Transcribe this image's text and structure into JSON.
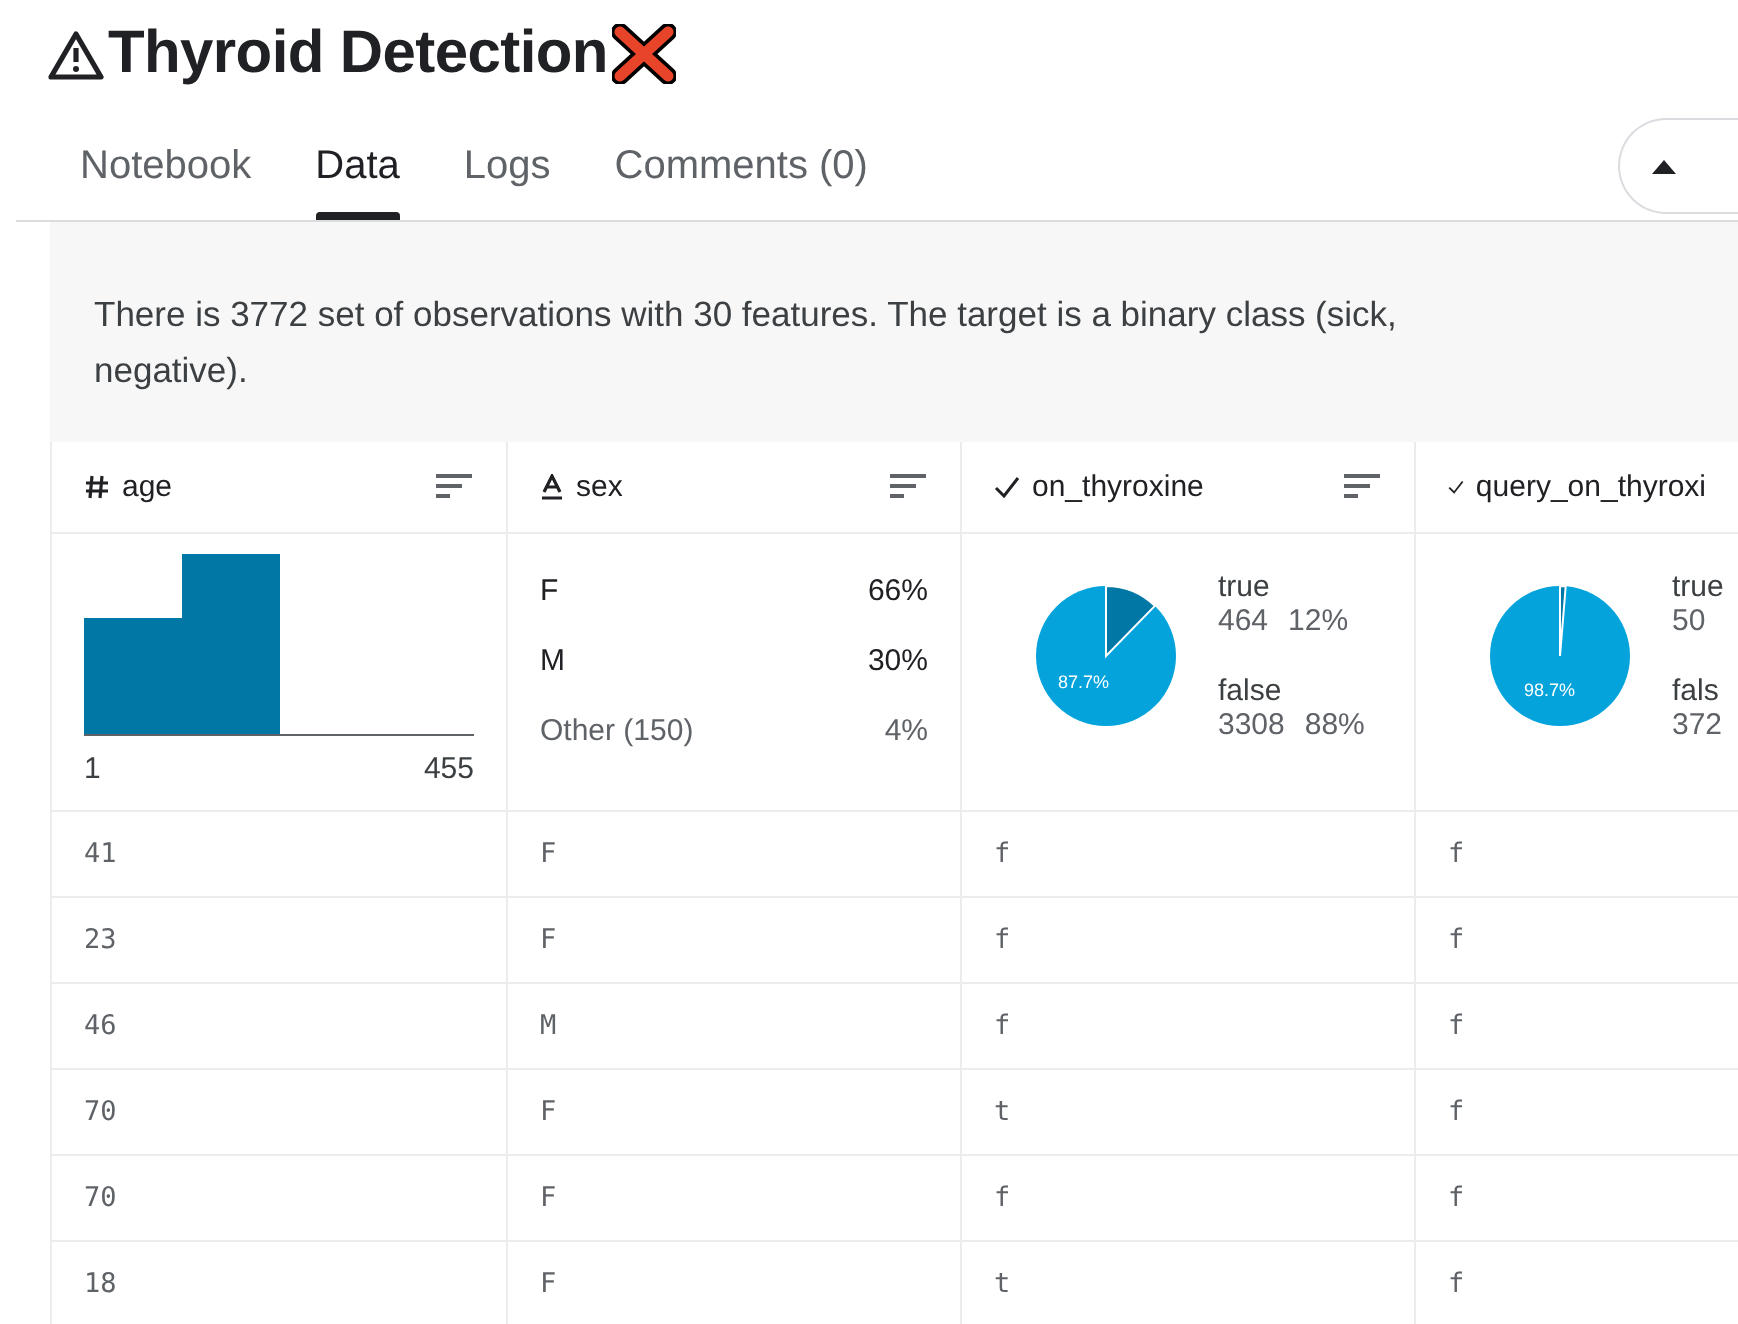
{
  "title": "Thyroid Detection",
  "tabs": [
    {
      "label": "Notebook",
      "selected": false
    },
    {
      "label": "Data",
      "selected": true
    },
    {
      "label": "Logs",
      "selected": false
    },
    {
      "label": "Comments (0)",
      "selected": false
    }
  ],
  "description": "There is 3772 set of observations with 30 features. The target is a binary class (sick, negative).",
  "columns": [
    {
      "name": "age",
      "kind": "numeric",
      "sort_icon": true,
      "summary": {
        "kind": "histogram",
        "min": "1",
        "max": "455"
      }
    },
    {
      "name": "sex",
      "kind": "string",
      "sort_icon": true,
      "summary": {
        "kind": "categories",
        "items": [
          {
            "label": "F",
            "share": "66%",
            "muted": false
          },
          {
            "label": "M",
            "share": "30%",
            "muted": false
          },
          {
            "label": "Other (150)",
            "share": "4%",
            "muted": true
          }
        ]
      }
    },
    {
      "name": "on_thyroxine",
      "kind": "boolean",
      "sort_icon": true,
      "summary": {
        "kind": "pie",
        "slice_label": "87.7%",
        "legend": [
          {
            "label": "true",
            "count": "464",
            "share": "12%"
          },
          {
            "label": "false",
            "count": "3308",
            "share": "88%"
          }
        ]
      }
    },
    {
      "name": "query_on_thyroxi",
      "kind": "boolean",
      "sort_icon": false,
      "summary": {
        "kind": "pie",
        "slice_label": "98.7%",
        "legend": [
          {
            "label": "true",
            "count": "50"
          },
          {
            "label": "fals",
            "count": "372"
          }
        ]
      }
    }
  ],
  "rows": [
    [
      "41",
      "F",
      "f",
      "f"
    ],
    [
      "23",
      "F",
      "f",
      "f"
    ],
    [
      "46",
      "M",
      "f",
      "f"
    ],
    [
      "70",
      "F",
      "t",
      "f"
    ],
    [
      "70",
      "F",
      "f",
      "f"
    ],
    [
      "18",
      "F",
      "t",
      "f"
    ]
  ]
}
